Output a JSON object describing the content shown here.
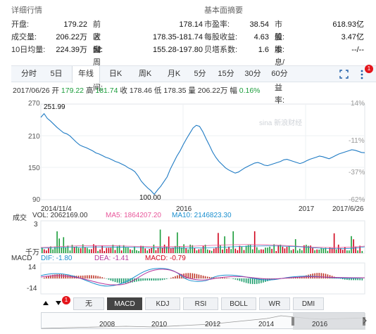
{
  "detail": {
    "title": "详细行情",
    "rows": [
      [
        {
          "label": "开盘:",
          "value": "179.22"
        },
        {
          "label": "前收盘:",
          "value": "178.14"
        }
      ],
      [
        {
          "label": "成交量:",
          "value": "206.22万"
        },
        {
          "label": "区间:",
          "value": "178.35-181.74"
        }
      ],
      [
        {
          "label": "10日均量:",
          "value": "224.39万"
        },
        {
          "label": "52周区间:",
          "value": "155.28-197.80"
        }
      ]
    ]
  },
  "fundamentals": {
    "title": "基本面摘要",
    "rows": [
      [
        {
          "label": "市盈率:",
          "value": "38.54"
        },
        {
          "label": "市值:",
          "value": "618.93亿"
        }
      ],
      [
        {
          "label": "每股收益:",
          "value": "4.63"
        },
        {
          "label": "股本:",
          "value": "3.47亿"
        }
      ],
      [
        {
          "label": "贝塔系数:",
          "value": "1.6"
        },
        {
          "label": "股息/收益率:",
          "value": "--/--"
        }
      ]
    ]
  },
  "tabs": [
    "分时",
    "5日",
    "年线",
    "日K",
    "周K",
    "月K",
    "5分",
    "15分",
    "30分",
    "60分"
  ],
  "active_tab": "年线",
  "tab_badge": "1",
  "quote": {
    "date": "2017/06/26",
    "open_label": "开",
    "open": "179.22",
    "high_label": "高",
    "high": "181.74",
    "close_label": "收",
    "close": "178.46",
    "low_label": "低",
    "low": "178.35",
    "vol_label": "量",
    "vol": "206.22万",
    "chg_label": "幅",
    "chg": "0.16%"
  },
  "price_chart": {
    "y_ticks_left": [
      "270",
      "210",
      "150",
      "90"
    ],
    "y_ticks_right": [
      "14%",
      "-11%",
      "-37%",
      "-62%"
    ],
    "x_ticks": [
      "2014/11/4",
      "2016",
      "2017",
      "2017/6/26"
    ],
    "max_label": "251.99",
    "min_label": "100.00",
    "watermark": "sina 新浪财经",
    "line_color": "#1f7bc4"
  },
  "volume": {
    "label": "成交",
    "vol": "VOL: 2062169.00",
    "ma5": "MA5: 1864207.20",
    "ma10": "MA10: 2146823.30",
    "y_top": "3",
    "y_unit": "千万"
  },
  "macd": {
    "label": "MACD",
    "dif": "DIF: -1.80",
    "dea": "DEA: -1.41",
    "macd": "MACD: -0.79",
    "y_top": "14",
    "y_bottom": "-14"
  },
  "indicator_tabs": [
    "无",
    "MACD",
    "KDJ",
    "RSI",
    "BOLL",
    "WR",
    "DMI"
  ],
  "active_indicator": "MACD",
  "indicator_badge": "1",
  "navigator": {
    "years": [
      "2008",
      "2010",
      "2012",
      "2014",
      "2016"
    ]
  },
  "chart_data": {
    "type": "line",
    "x_ticks": [
      "2014/11/4",
      "2016",
      "2017",
      "2017/6/26"
    ],
    "ylim": [
      90,
      270
    ],
    "y_ticks": [
      270,
      210,
      150,
      90
    ],
    "annotations": [
      "251.99",
      "100.00"
    ],
    "values": [
      245,
      251.99,
      243,
      238,
      232,
      226,
      221,
      216,
      214,
      210,
      204,
      198,
      193,
      190,
      188,
      185,
      182,
      178,
      176,
      173,
      170,
      168,
      165,
      162,
      160,
      157,
      154,
      150,
      147,
      143,
      135,
      125,
      118,
      112,
      107,
      100,
      108,
      115,
      124,
      133,
      148,
      160,
      172,
      182,
      194,
      205,
      215,
      225,
      230,
      228,
      218,
      205,
      193,
      180,
      170,
      162,
      156,
      150,
      146,
      143,
      140,
      142,
      146,
      150,
      153,
      156,
      159,
      160,
      158,
      155,
      154,
      156,
      158,
      160,
      162,
      165,
      166,
      164,
      162,
      160,
      158,
      160,
      163,
      166,
      168,
      170,
      172,
      171,
      169,
      167,
      170,
      173,
      176,
      178,
      180,
      182,
      184,
      183,
      181,
      179,
      178.46
    ]
  }
}
